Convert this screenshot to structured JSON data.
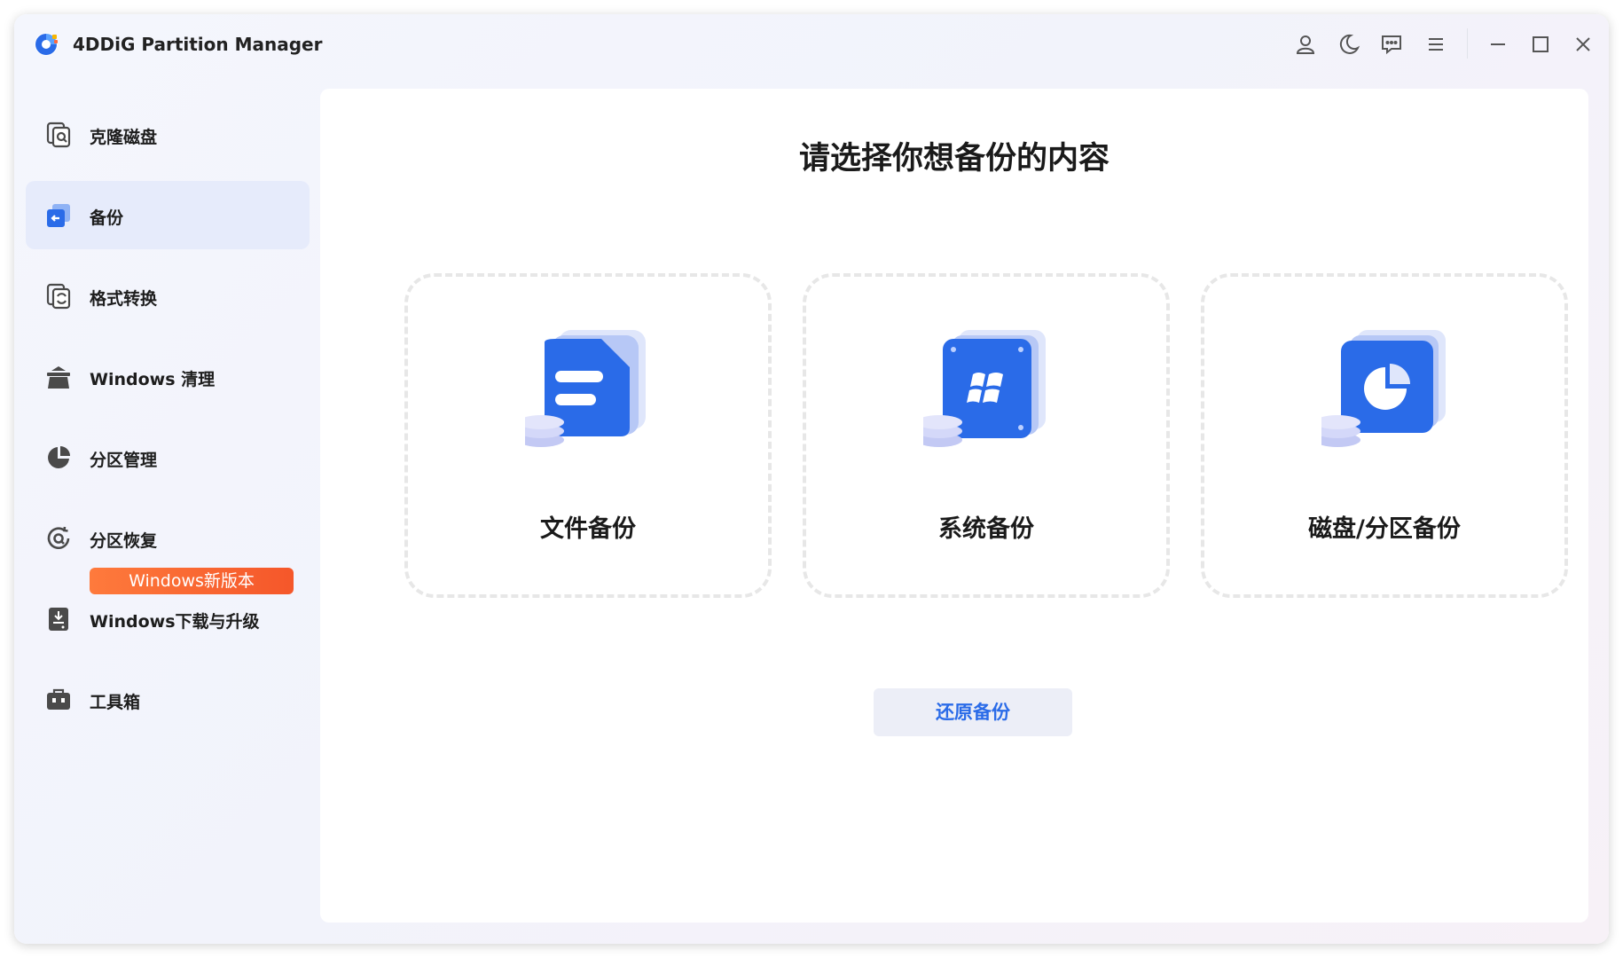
{
  "app": {
    "title": "4DDiG Partition Manager"
  },
  "titlebar": {
    "icons": [
      "user-icon",
      "moon-icon",
      "feedback-icon",
      "menu-icon",
      "minimize-icon",
      "maximize-icon",
      "close-icon"
    ]
  },
  "sidebar": {
    "items": [
      {
        "label": "克隆磁盘",
        "icon": "clone-disk-icon"
      },
      {
        "label": "备份",
        "icon": "backup-icon",
        "active": true
      },
      {
        "label": "格式转换",
        "icon": "convert-icon"
      },
      {
        "label": "Windows 清理",
        "icon": "clean-icon"
      },
      {
        "label": "分区管理",
        "icon": "partition-icon"
      },
      {
        "label": "分区恢复",
        "icon": "recovery-icon"
      },
      {
        "label": "Windows下载与升级",
        "icon": "download-icon"
      },
      {
        "label": "工具箱",
        "icon": "toolbox-icon"
      }
    ],
    "new_badge": "Windows新版本"
  },
  "main": {
    "title": "请选择你想备份的内容",
    "cards": [
      {
        "label": "文件备份",
        "icon": "file-backup-icon"
      },
      {
        "label": "系统备份",
        "icon": "system-backup-icon"
      },
      {
        "label": "磁盘/分区备份",
        "icon": "disk-partition-backup-icon"
      }
    ],
    "restore_label": "还原备份"
  },
  "colors": {
    "accent": "#2a6be8",
    "active_bg": "#e6ebfb",
    "badge": "#f5572a"
  }
}
